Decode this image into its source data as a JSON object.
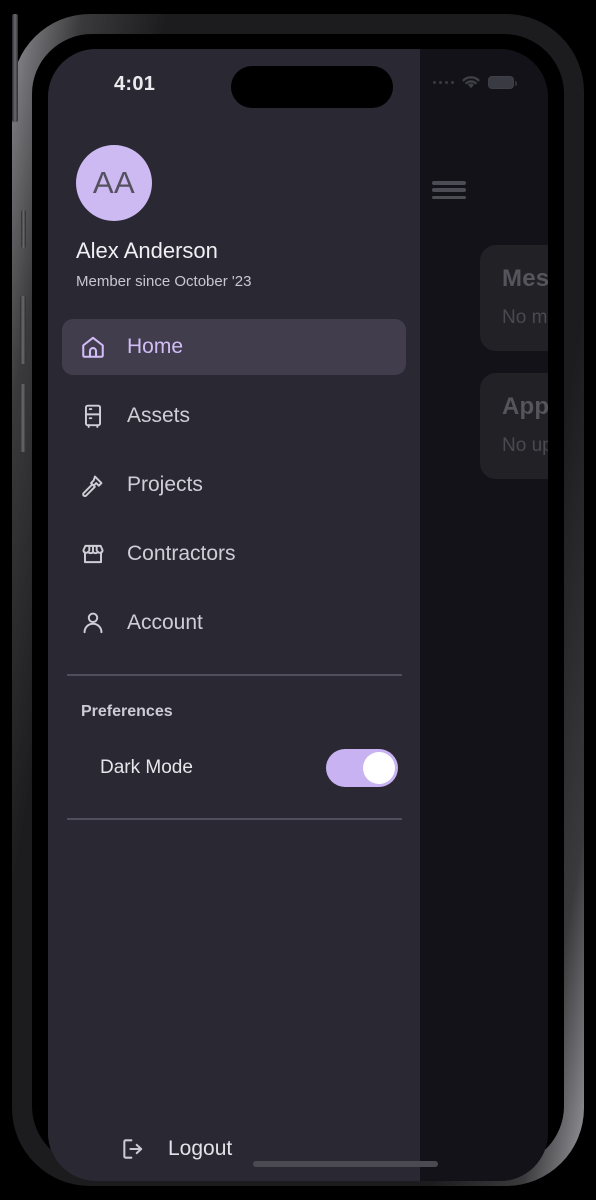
{
  "status_bar": {
    "time": "4:01",
    "wifi_icon": "wifi-icon",
    "battery_icon": "battery-icon",
    "signal_icon": "signal-dots-icon"
  },
  "background_page": {
    "menu_icon": "hamburger-menu-icon",
    "cards": [
      {
        "title": "Messages",
        "subtitle": "No message"
      },
      {
        "title": "Appointm",
        "subtitle": "No upcoming"
      }
    ]
  },
  "drawer": {
    "profile": {
      "initials": "AA",
      "name": "Alex Anderson",
      "member_since": "Member since October '23"
    },
    "nav_items": [
      {
        "label": "Home",
        "icon": "home-icon",
        "active": true
      },
      {
        "label": "Assets",
        "icon": "cabinet-icon",
        "active": false
      },
      {
        "label": "Projects",
        "icon": "hammer-icon",
        "active": false
      },
      {
        "label": "Contractors",
        "icon": "storefront-icon",
        "active": false
      },
      {
        "label": "Account",
        "icon": "person-icon",
        "active": false
      }
    ],
    "preferences": {
      "title": "Preferences",
      "dark_mode": {
        "label": "Dark Mode",
        "enabled": true
      }
    },
    "logout": {
      "label": "Logout",
      "icon": "logout-icon"
    }
  },
  "colors": {
    "accent": "#d2bdf8",
    "toggle_on": "#c8b2f2",
    "drawer_bg": "#2a2832",
    "active_item_bg": "#413d4c",
    "page_bg": "#131218"
  }
}
